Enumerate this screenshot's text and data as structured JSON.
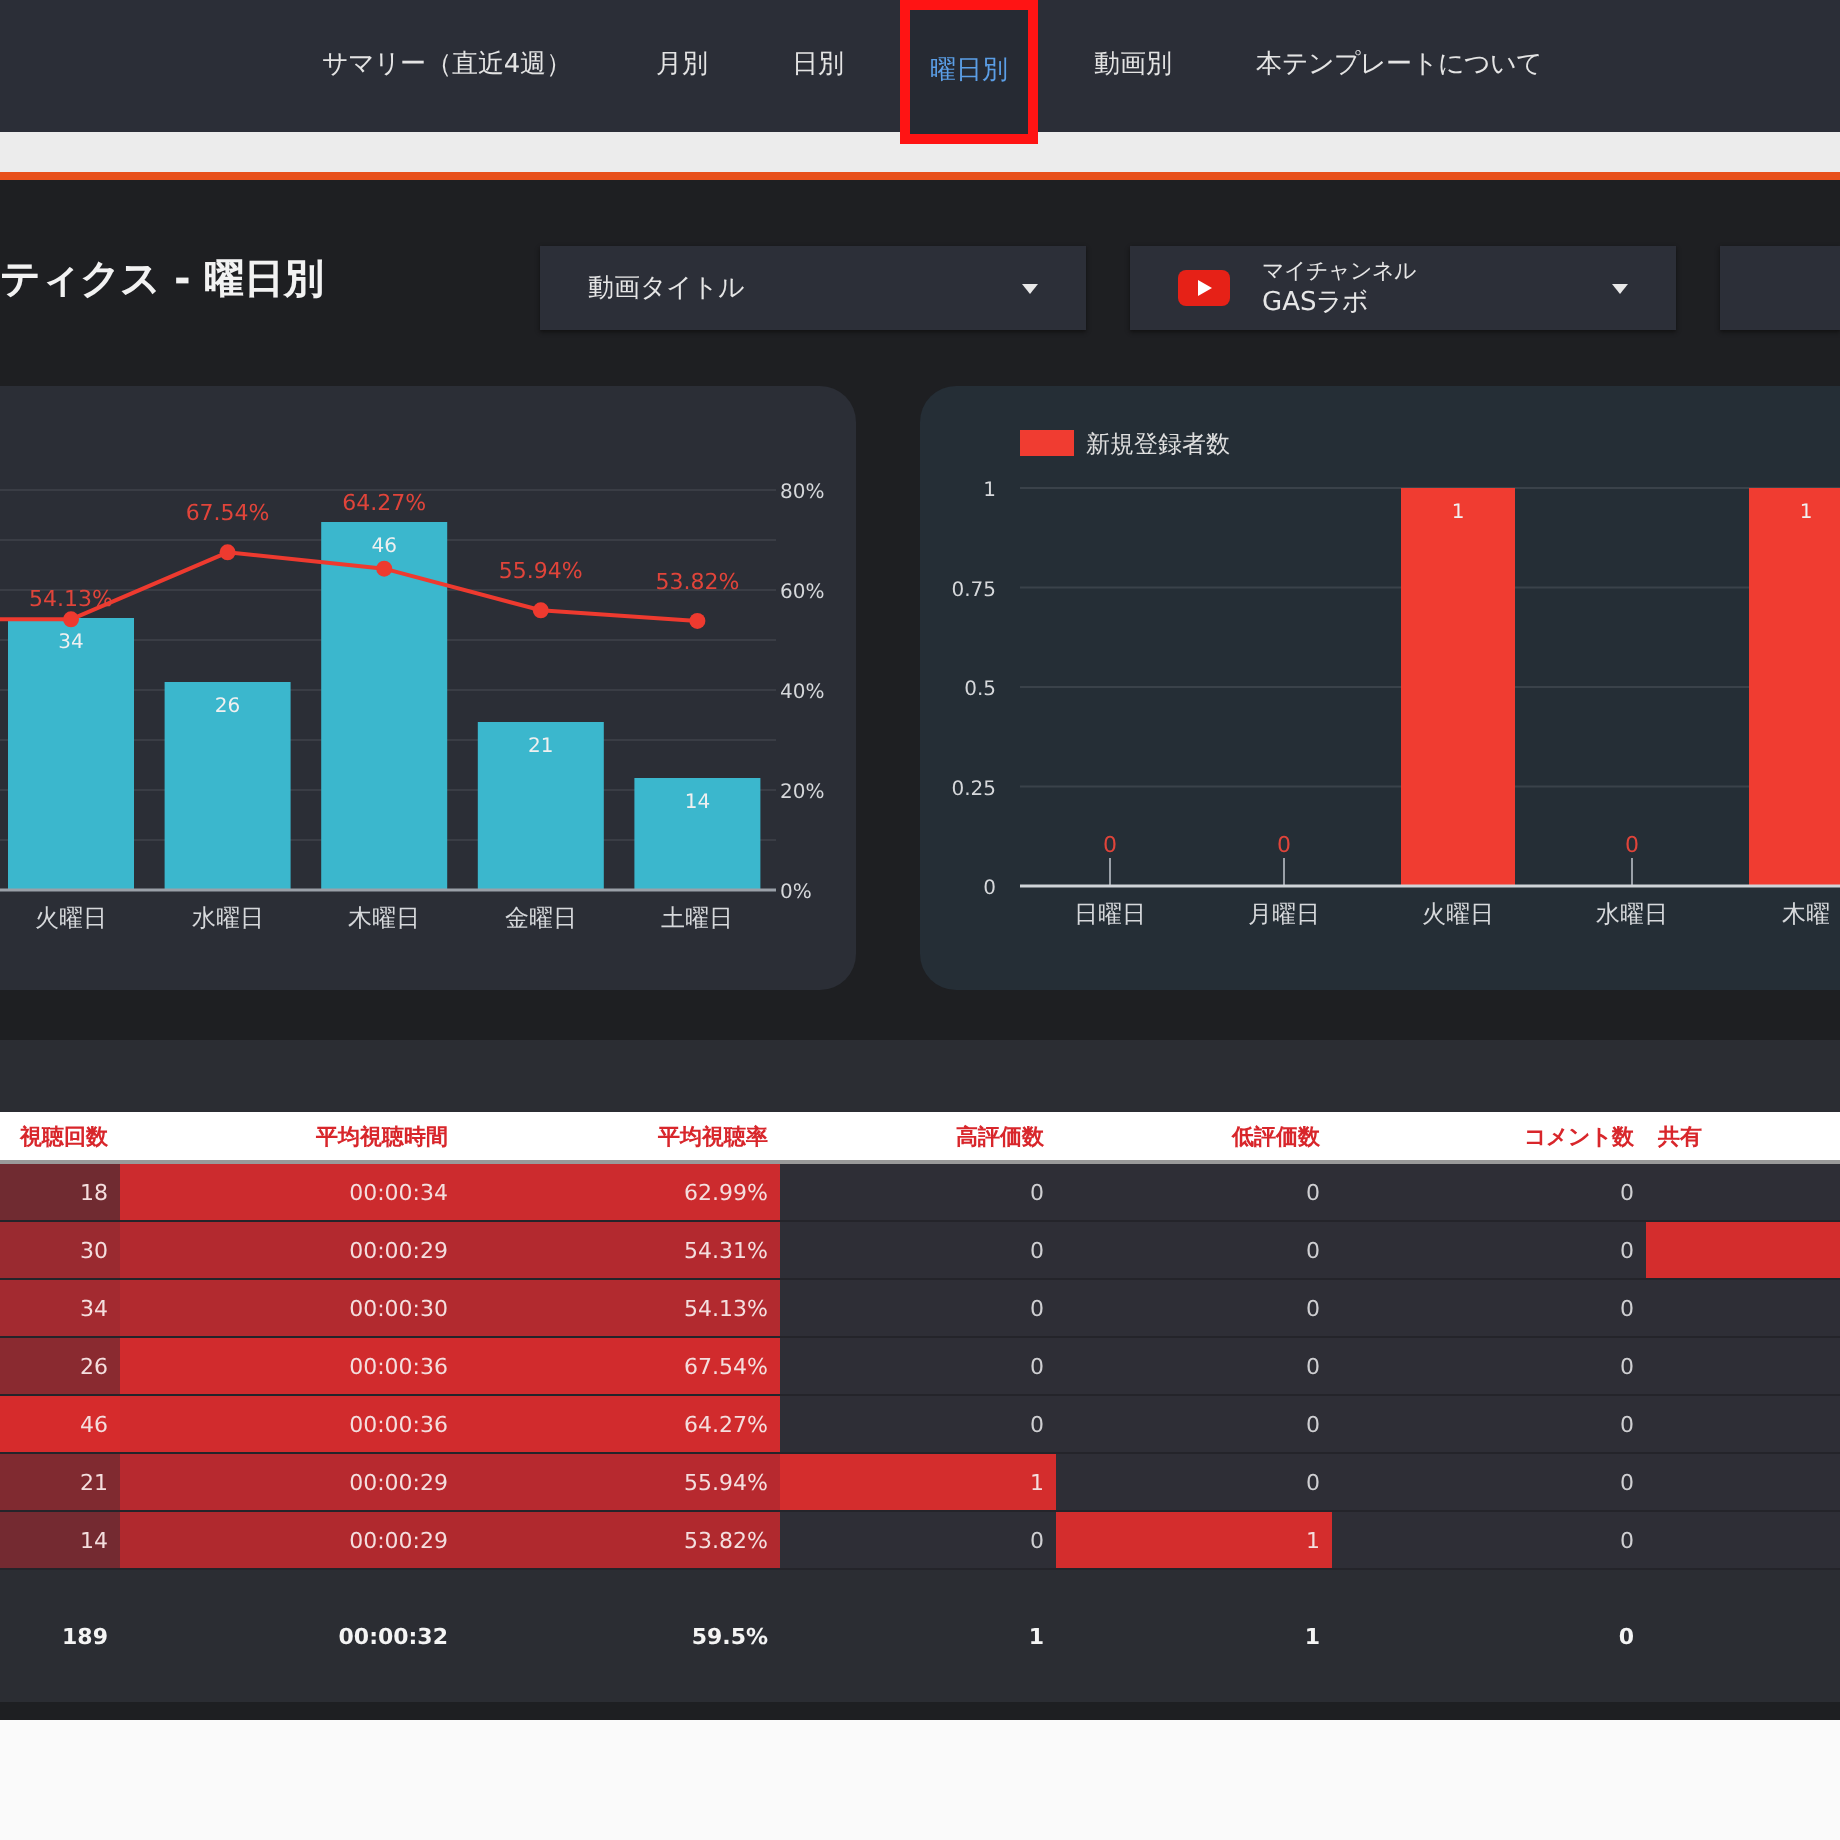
{
  "nav": {
    "tabs": [
      {
        "label": "サマリー（直近4週）",
        "selected": false
      },
      {
        "label": "月別",
        "selected": false
      },
      {
        "label": "日別",
        "selected": false
      },
      {
        "label": "曜日別",
        "selected": true
      },
      {
        "label": "動画別",
        "selected": false
      },
      {
        "label": "本テンプレートについて",
        "selected": false
      }
    ]
  },
  "page_title": "ティクス - 曜日別",
  "filters": [
    {
      "kind": "plain",
      "label": "動画タイトル"
    },
    {
      "kind": "channel",
      "label": "マイチャンネル",
      "value": "GASラボ"
    },
    {
      "kind": "blank"
    }
  ],
  "charts": [
    {
      "chart_data": {
        "type": "bar",
        "categories": [
          "火曜日",
          "水曜日",
          "木曜日",
          "金曜日",
          "土曜日"
        ],
        "series": [
          {
            "type": "bar",
            "axis": "y2",
            "color": "#3bb7cd",
            "values": [
              34,
              26,
              46,
              21,
              14
            ],
            "value_labels": [
              "34",
              "26",
              "46",
              "21",
              "14"
            ]
          },
          {
            "type": "line",
            "color": "#ee3a2f",
            "marker": true,
            "values": [
              54.13,
              67.54,
              64.27,
              55.94,
              53.82
            ],
            "value_labels": [
              "54.13%",
              "67.54%",
              "64.27%",
              "55.94%",
              "53.82%"
            ]
          }
        ],
        "yticks": [
          {
            "value": 0,
            "label": "0%"
          },
          {
            "value": 20,
            "label": "20%"
          },
          {
            "value": 40,
            "label": "40%"
          },
          {
            "value": 60,
            "label": "60%"
          },
          {
            "value": 80,
            "label": "80%"
          }
        ],
        "ylim": [
          0,
          80
        ],
        "y2lim": [
          0,
          50
        ],
        "grid": true
      }
    },
    {
      "chart_data": {
        "type": "bar",
        "categories": [
          "日曜日",
          "月曜日",
          "火曜日",
          "水曜日",
          "木曜"
        ],
        "series": [
          {
            "name": "新規登録者数",
            "color": "#f03c31",
            "values": [
              0,
              0,
              1,
              0,
              1
            ],
            "value_labels": [
              "0",
              "0",
              "1",
              "0",
              "1"
            ]
          }
        ],
        "yticks": [
          0,
          0.25,
          0.5,
          0.75,
          1
        ],
        "ylim": [
          0,
          1
        ],
        "grid": true
      }
    }
  ],
  "table": {
    "columns": [
      "視聴回数",
      "平均視聴時間",
      "平均視聴率",
      "高評価数",
      "低評価数",
      "コメント数",
      "共有"
    ],
    "rows": [
      {
        "cells": [
          {
            "text": "18",
            "color": "#702b31"
          },
          {
            "text": "00:00:34",
            "color": "#cc2b2e"
          },
          {
            "text": "62.99%",
            "color": "#cc2b2e"
          },
          {
            "text": "0"
          },
          {
            "text": "0"
          },
          {
            "text": "0"
          }
        ]
      },
      {
        "cells": [
          {
            "text": "30",
            "color": "#9a2a30"
          },
          {
            "text": "00:00:29",
            "color": "#b3292f"
          },
          {
            "text": "54.31%",
            "color": "#b3292f"
          },
          {
            "text": "0"
          },
          {
            "text": "0"
          },
          {
            "text": "0"
          },
          {
            "color": "#d42d2d"
          }
        ]
      },
      {
        "cells": [
          {
            "text": "34",
            "color": "#a32a30"
          },
          {
            "text": "00:00:30",
            "color": "#b22a2f"
          },
          {
            "text": "54.13%",
            "color": "#b22a2f"
          },
          {
            "text": "0"
          },
          {
            "text": "0"
          },
          {
            "text": "0"
          }
        ]
      },
      {
        "cells": [
          {
            "text": "26",
            "color": "#8a2a30"
          },
          {
            "text": "00:00:36",
            "color": "#d12b2d"
          },
          {
            "text": "67.54%",
            "color": "#d12b2d"
          },
          {
            "text": "0"
          },
          {
            "text": "0"
          },
          {
            "text": "0"
          }
        ]
      },
      {
        "cells": [
          {
            "text": "46",
            "color": "#d62b2c"
          },
          {
            "text": "00:00:36",
            "color": "#d12b2d"
          },
          {
            "text": "64.27%",
            "color": "#d12b2d"
          },
          {
            "text": "0"
          },
          {
            "text": "0"
          },
          {
            "text": "0"
          }
        ]
      },
      {
        "cells": [
          {
            "text": "21",
            "color": "#802a30"
          },
          {
            "text": "00:00:29",
            "color": "#b7292f"
          },
          {
            "text": "55.94%",
            "color": "#b7292f"
          },
          {
            "text": "1",
            "color": "#d42d2d"
          },
          {
            "text": "0"
          },
          {
            "text": "0"
          }
        ]
      },
      {
        "cells": [
          {
            "text": "14",
            "color": "#742a31"
          },
          {
            "text": "00:00:29",
            "color": "#b0292e"
          },
          {
            "text": "53.82%",
            "color": "#b0292e"
          },
          {
            "text": "0"
          },
          {
            "text": "1",
            "color": "#d42d2d"
          },
          {
            "text": "0"
          }
        ]
      }
    ],
    "totals": [
      "189",
      "00:00:32",
      "59.5%",
      "1",
      "1",
      "0"
    ]
  }
}
